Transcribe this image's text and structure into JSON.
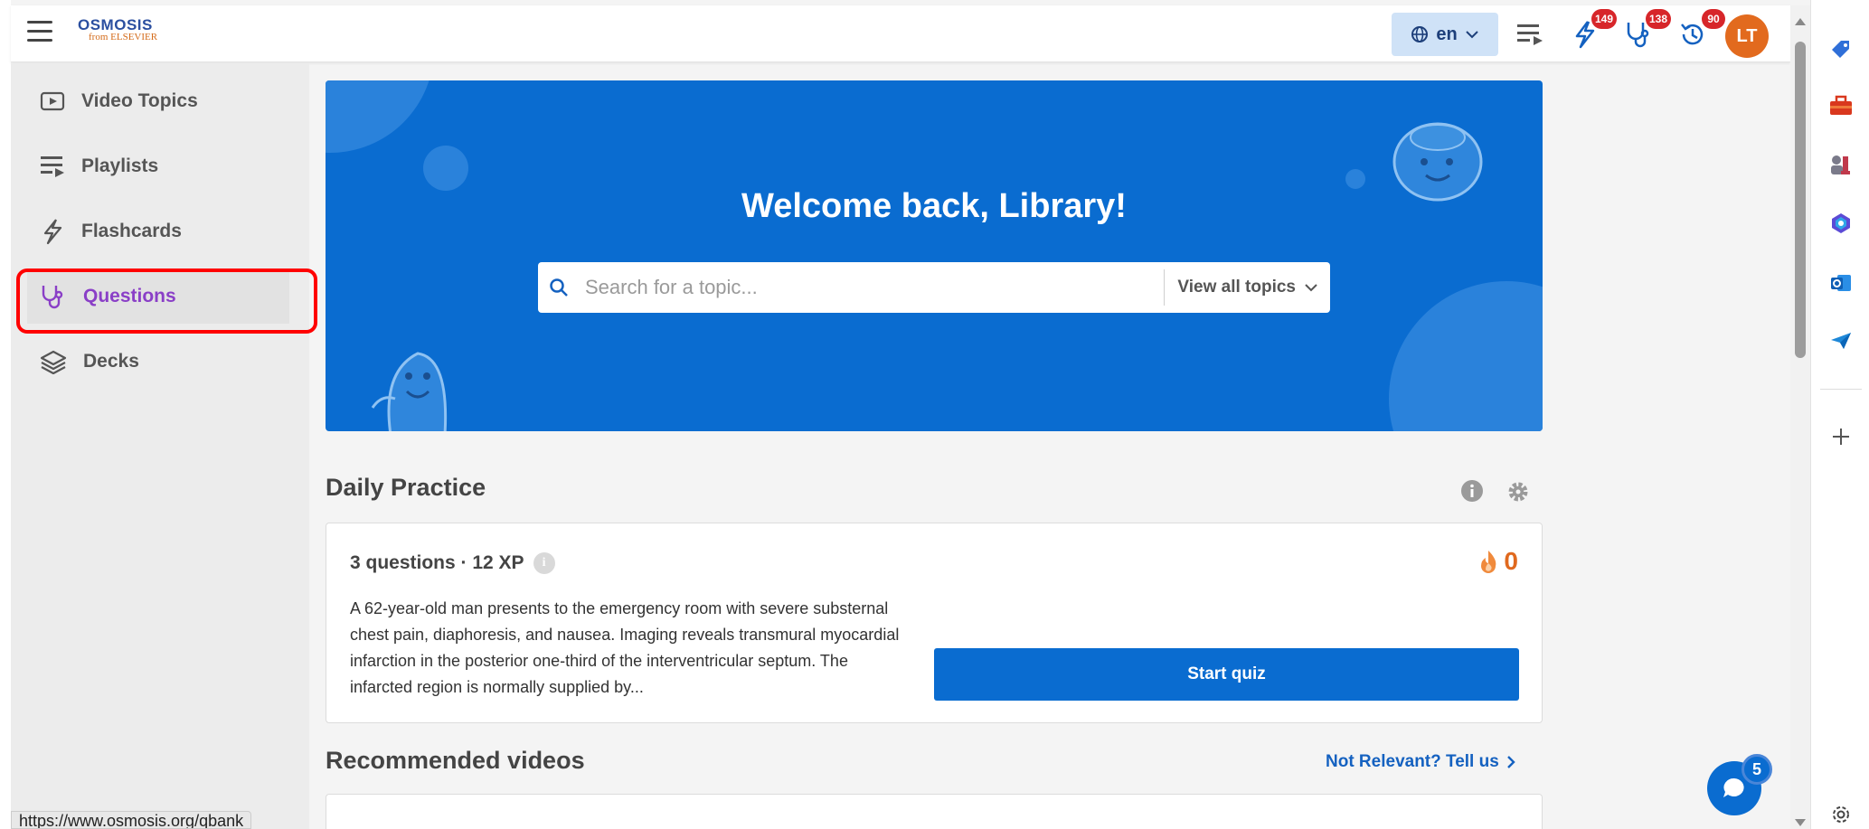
{
  "header": {
    "logo_text": "OSMOSIS",
    "logo_sub": "from ELSEVIER",
    "language": "en",
    "badges": {
      "flashcards": "149",
      "questions": "138",
      "history": "90"
    },
    "avatar_initials": "LT"
  },
  "sidebar": {
    "items": [
      {
        "label": "Video Topics",
        "icon": "video-play-icon"
      },
      {
        "label": "Playlists",
        "icon": "playlist-icon"
      },
      {
        "label": "Flashcards",
        "icon": "lightning-icon"
      },
      {
        "label": "Questions",
        "icon": "stethoscope-icon",
        "active": true
      },
      {
        "label": "Decks",
        "icon": "layers-icon"
      }
    ]
  },
  "hero": {
    "title": "Welcome back, Library!",
    "search_placeholder": "Search for a topic...",
    "view_all": "View all topics"
  },
  "daily_practice": {
    "title": "Daily Practice",
    "meta": "3 questions · 12 XP",
    "streak": "0",
    "stem": "A 62-year-old man presents to the emergency room with severe substernal chest pain, diaphoresis, and nausea. Imaging reveals transmural myocardial infarction in the posterior one-third of the interventricular septum. The infarcted region is normally supplied by...",
    "start_label": "Start quiz"
  },
  "recommended": {
    "title": "Recommended videos",
    "not_relevant": "Not Relevant? Tell us"
  },
  "chat": {
    "count": "5"
  },
  "status_url": "https://www.osmosis.org/qbank",
  "colors": {
    "brand_blue": "#0a6cd0",
    "active_purple": "#8a3fc7",
    "badge_red": "#d7262a",
    "streak_orange": "#e0691e"
  }
}
